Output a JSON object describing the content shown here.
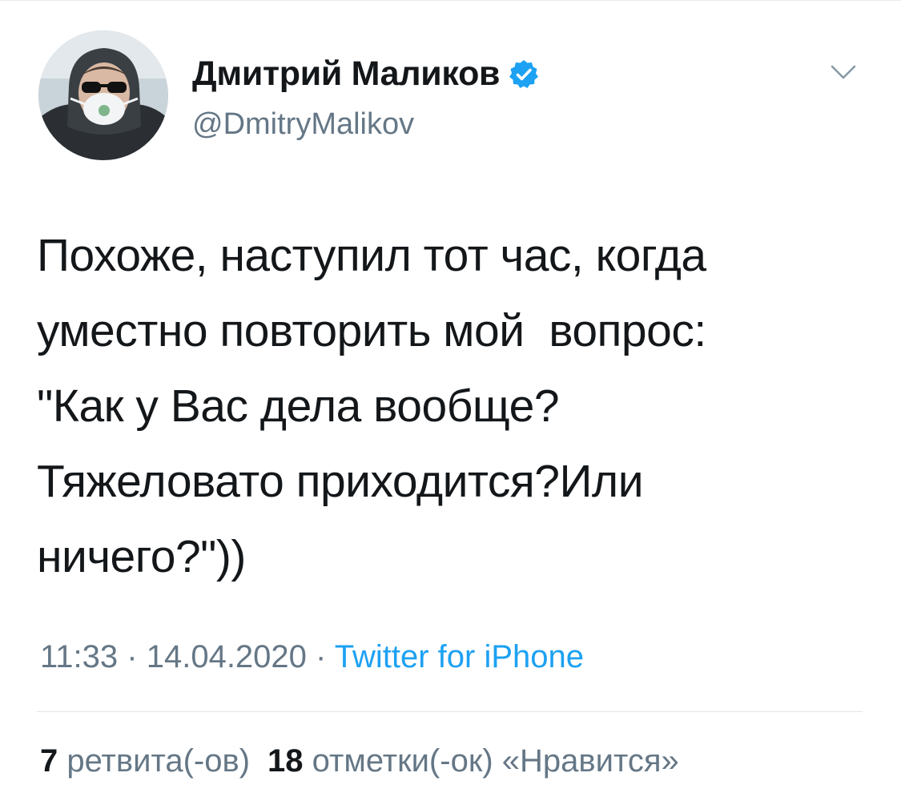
{
  "tweet": {
    "author": {
      "display_name": "Дмитрий Маликов",
      "handle": "@DmitryMalikov",
      "verified": true
    },
    "text": "Похоже, наступил тот час, когда\nуместно повторить мой  вопрос:\n\"Как у Вас дела вообще?\nТяжеловато приходится?Или\nничего?\"))",
    "time": "11:33",
    "separator": "·",
    "date": "14.04.2020",
    "source": "Twitter for iPhone",
    "stats": {
      "retweets_count": "7",
      "retweets_label": "ретвита(-ов)",
      "likes_count": "18",
      "likes_label": "отметки(-ок) «Нравится»"
    }
  },
  "colors": {
    "text": "#14171a",
    "secondary": "#657786",
    "accent": "#1da1f2",
    "divider": "#dfe5ea"
  },
  "icons": {
    "verified": "verified-badge-icon",
    "menu": "chevron-down-icon"
  }
}
